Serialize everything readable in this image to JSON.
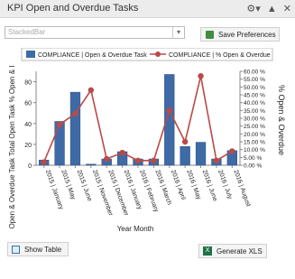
{
  "window": {
    "title": "KPI Open and Overdue Tasks"
  },
  "toolbar": {
    "settings_icon": "gear-icon",
    "collapse_icon": "caret-up-icon",
    "close_icon": "close-icon"
  },
  "chart_select": {
    "value": "StackedBar"
  },
  "save_button": {
    "label": "Save Preferences"
  },
  "show_table_button": {
    "label": "Show Table"
  },
  "generate_xls_button": {
    "label": "Generate XLS"
  },
  "chart_data": {
    "type": "bar",
    "categories": [
      "2015 | January",
      "2015 | May",
      "2015 | June",
      "2015 | November",
      "2015 | December",
      "2016 | January",
      "2016 | February",
      "2016 | March",
      "2016 | April",
      "2016 | May",
      "2016 | June",
      "2016 | July",
      "2016 | August"
    ],
    "series": [
      {
        "name": "COMPLIANCE | Open & Overdue Task",
        "type": "bar",
        "axis": "left",
        "color": "#3e6aa6",
        "values": [
          5,
          42,
          70,
          1,
          6,
          13,
          6,
          6,
          87,
          18,
          22,
          6,
          14
        ]
      },
      {
        "name": "COMPLIANCE | % Open & Overdue",
        "type": "line",
        "axis": "right",
        "color": "#b94a48",
        "values": [
          2,
          26,
          33,
          48,
          4,
          8,
          3,
          3,
          35,
          15,
          57,
          3,
          9
        ]
      }
    ],
    "xlabel": "Year Month",
    "ylabel": "Open & Overdue Task Total Open Task % Open & I",
    "y2label": "% Open & Overdue",
    "ylim": [
      0,
      90
    ],
    "y2lim": [
      0,
      60
    ],
    "yticks": [
      0,
      20,
      40,
      60,
      80
    ],
    "y2ticks": [
      "0.00 %",
      "5.00 %",
      "10.00 %",
      "15.00 %",
      "20.00 %",
      "25.00 %",
      "30.00 %",
      "35.00 %",
      "40.00 %",
      "45.00 %",
      "50.00 %",
      "55.00 %",
      "60.00 %"
    ],
    "legend_position": "top"
  }
}
